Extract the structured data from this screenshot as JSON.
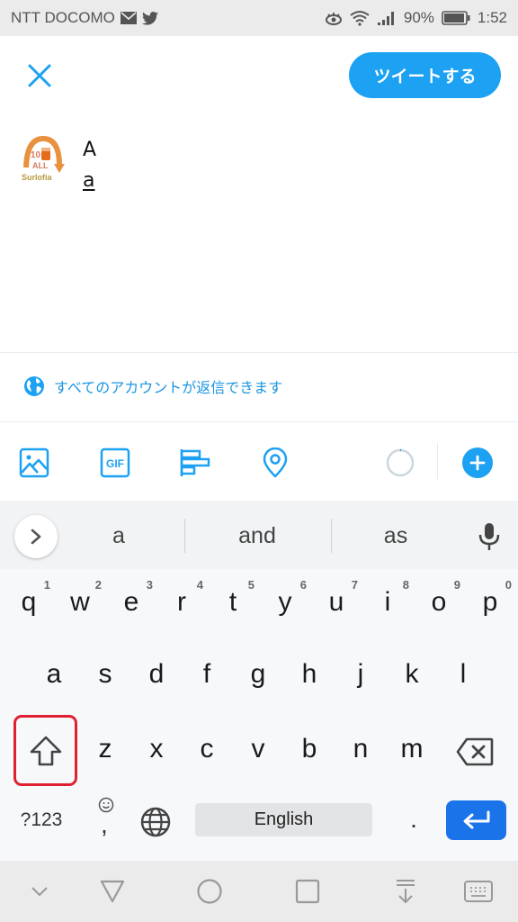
{
  "status_bar": {
    "carrier": "NTT DOCOMO",
    "notification_icons": [
      "mail-icon",
      "twitter-icon"
    ],
    "system_icons": [
      "eye-comfort-icon",
      "wifi-icon",
      "signal-icon"
    ],
    "battery": "90%",
    "time": "1:52"
  },
  "header": {
    "close_icon": "close-icon",
    "tweet_button": "ツイートする"
  },
  "composer": {
    "avatar_label": "Surlofia",
    "avatar_badge_top": "10",
    "avatar_badge_mid": "ALL",
    "text_lines": [
      "A",
      "a"
    ]
  },
  "reply_setting": {
    "icon": "globe-icon",
    "label": "すべてのアカウントが返信できます"
  },
  "toolbar": {
    "items": [
      "image-icon",
      "gif-icon",
      "poll-icon",
      "location-icon"
    ],
    "gif_label": "GIF",
    "char_counter_progress": 0.01,
    "add_icon": "plus-icon"
  },
  "accent_color": "#1da1f2",
  "keyboard": {
    "suggestions": [
      "a",
      "and",
      "as"
    ],
    "row1": [
      {
        "key": "q",
        "hint": "1"
      },
      {
        "key": "w",
        "hint": "2"
      },
      {
        "key": "e",
        "hint": "3"
      },
      {
        "key": "r",
        "hint": "4"
      },
      {
        "key": "t",
        "hint": "5"
      },
      {
        "key": "y",
        "hint": "6"
      },
      {
        "key": "u",
        "hint": "7"
      },
      {
        "key": "i",
        "hint": "8"
      },
      {
        "key": "o",
        "hint": "9"
      },
      {
        "key": "p",
        "hint": "0"
      }
    ],
    "row2": [
      "a",
      "s",
      "d",
      "f",
      "g",
      "h",
      "j",
      "k",
      "l"
    ],
    "row3": [
      "z",
      "x",
      "c",
      "v",
      "b",
      "n",
      "m"
    ],
    "symbols_key": "?123",
    "comma_key": ",",
    "space_label": "English",
    "period_key": ".",
    "highlighted_key": "shift"
  },
  "nav_bar": {
    "buttons": [
      "hide-icon",
      "back-icon",
      "home-icon",
      "recents-icon",
      "notification-pull-icon",
      "keyboard-switch-icon"
    ]
  }
}
